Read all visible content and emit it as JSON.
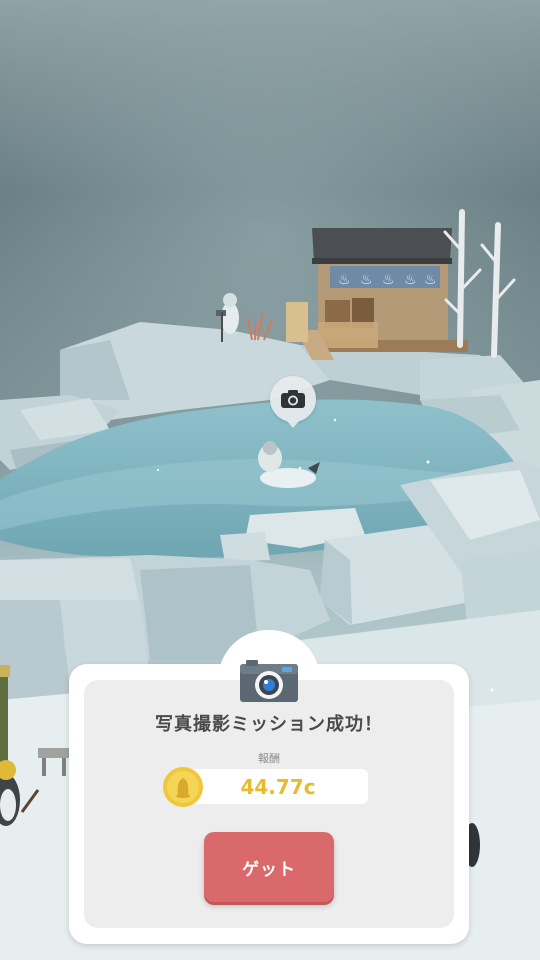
{
  "mission_dialog": {
    "title": "写真撮影ミッション成功！",
    "reward_label": "報酬",
    "reward_value": "44.77c",
    "get_button_label": "ゲット",
    "icon": "camera-icon"
  },
  "scene": {
    "photo_spot_icon": "camera-icon",
    "description_free": true
  },
  "colors": {
    "button": "#d9696a",
    "reward_text": "#e8bb2e",
    "title_text": "#4a4a4a",
    "panel": "#ffffff",
    "panel_inner": "#ededee"
  }
}
